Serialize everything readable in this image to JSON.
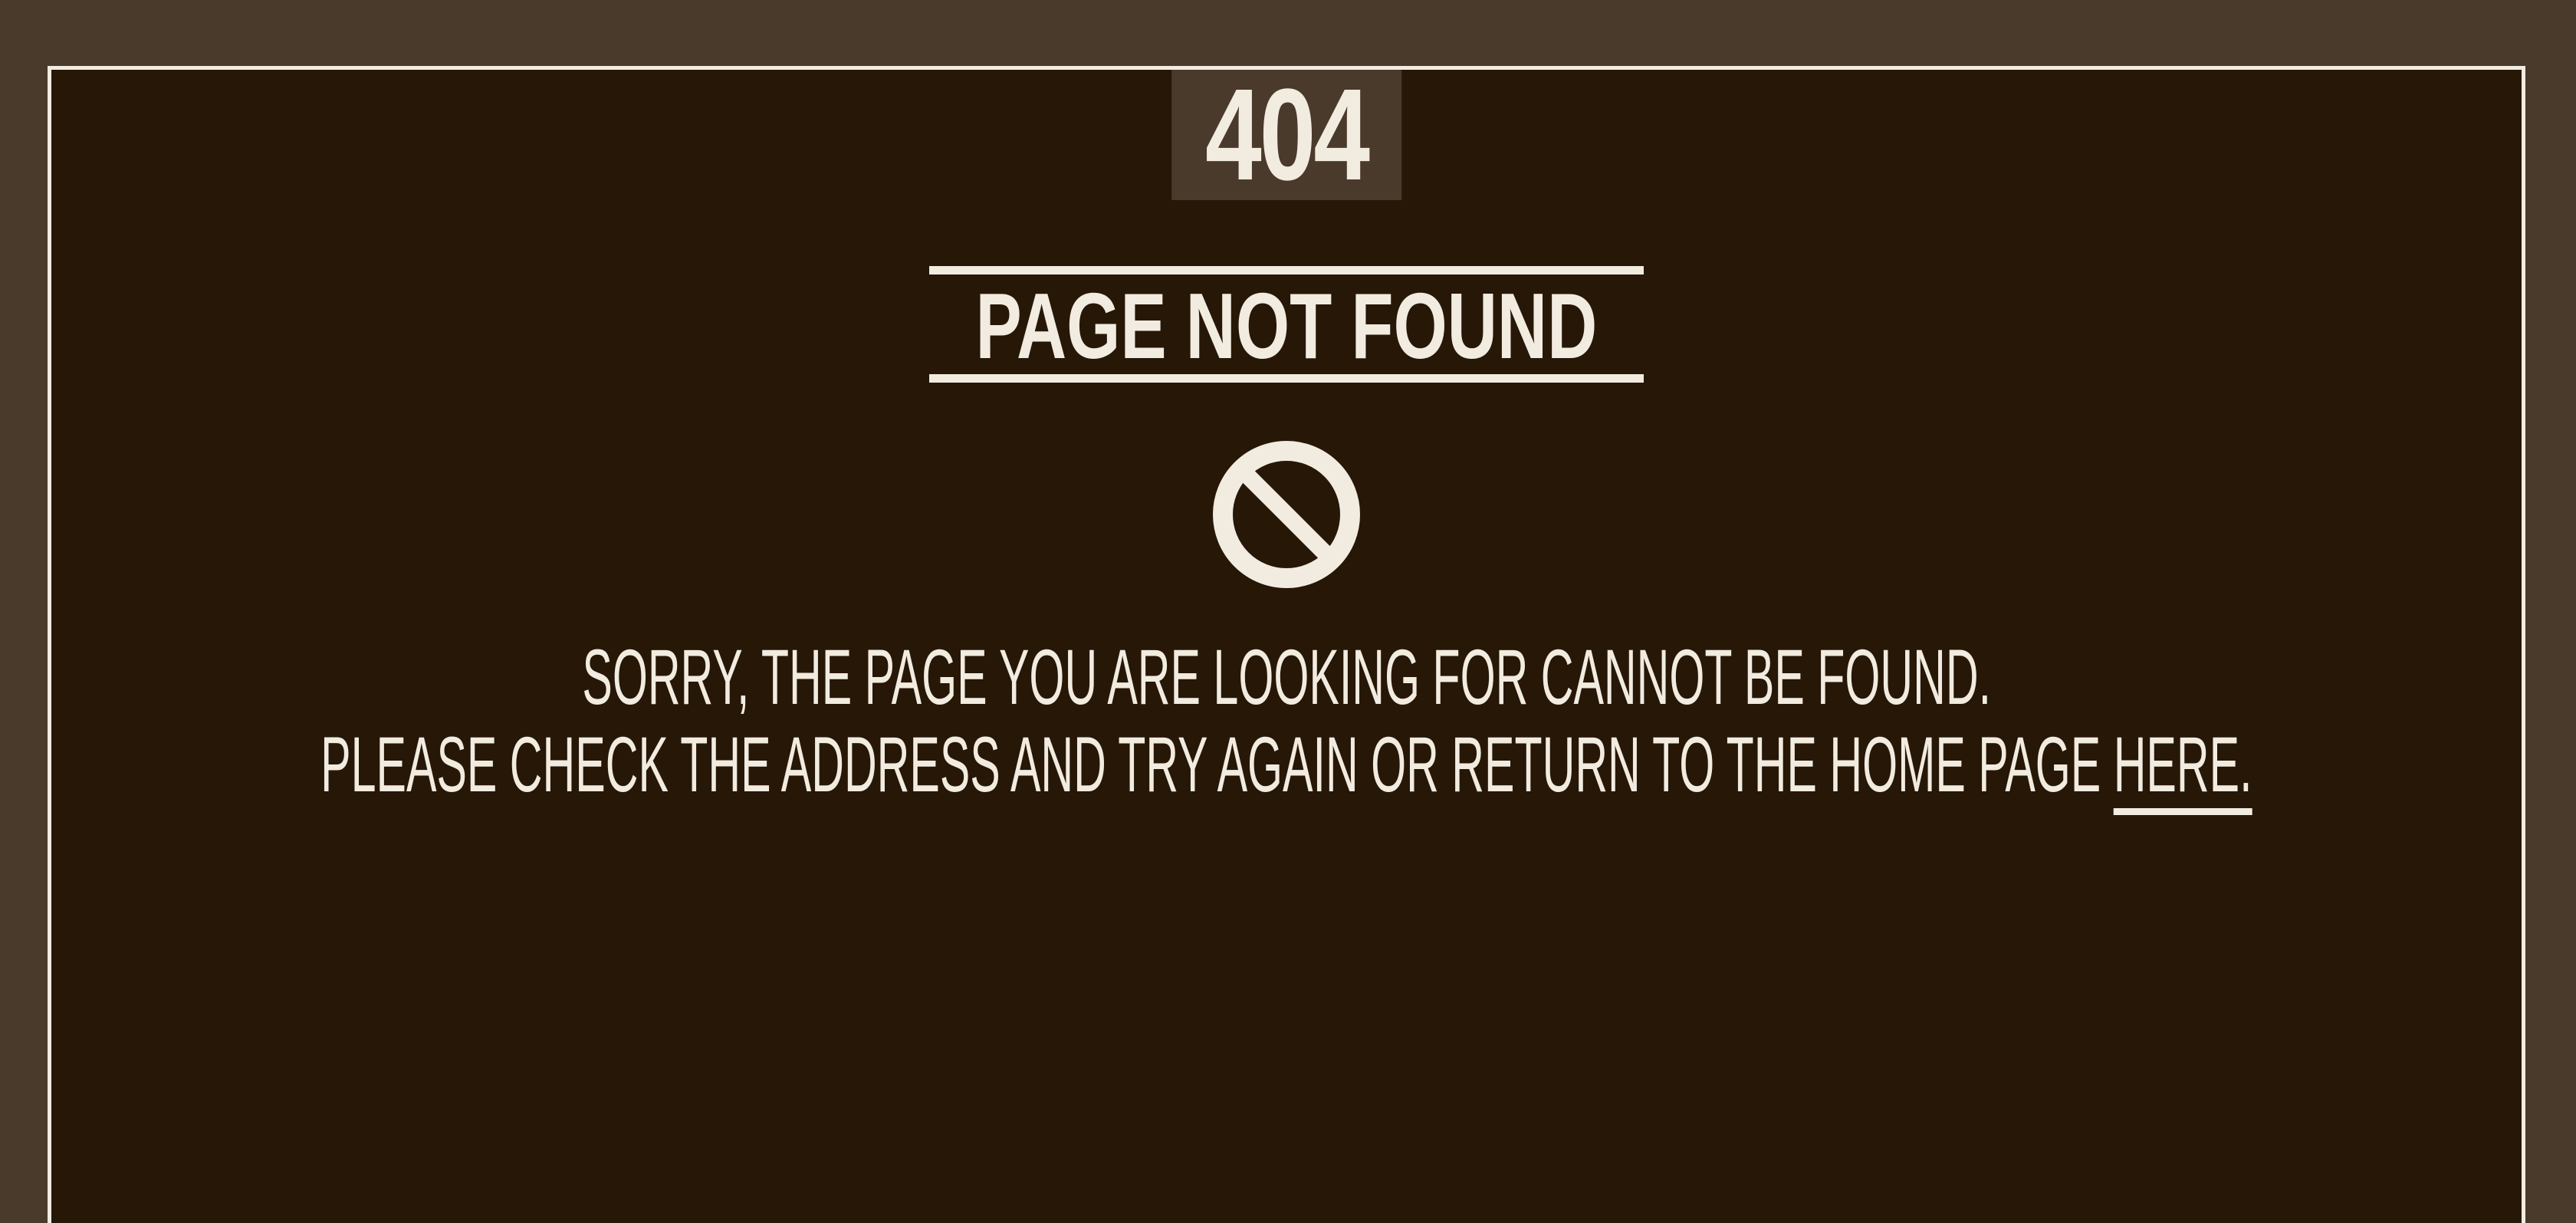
{
  "error": {
    "code": "404",
    "title": "PAGE NOT FOUND",
    "icon": "prohibited-icon"
  },
  "message": {
    "line1": "SORRY, THE PAGE YOU ARE LOOKING FOR CANNOT BE FOUND.",
    "line2_text": "PLEASE CHECK THE ADDRESS AND TRY AGAIN OR RETURN TO THE HOME PAGE ",
    "link_label": "HERE."
  },
  "colors": {
    "outer_background": "#4a3a2c",
    "panel_background": "#261707",
    "foreground": "#f2ebe0"
  }
}
